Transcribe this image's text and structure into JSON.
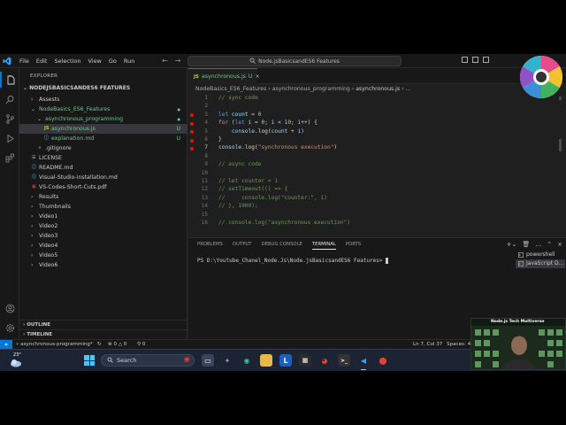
{
  "titlebar": {
    "menu": [
      "File",
      "Edit",
      "Selection",
      "View",
      "Go",
      "Run"
    ],
    "command_center": "Node.jsBasicsandES6 Features"
  },
  "sidebar": {
    "title": "EXPLORER",
    "root": "NODEJSBASICSANDES6 FEATURES",
    "items": [
      {
        "label": "Assests",
        "indent": 1,
        "type": "folder",
        "open": false
      },
      {
        "label": "NodeBasics_ES6_Features",
        "indent": 1,
        "type": "folder",
        "open": true,
        "color": "#73c991"
      },
      {
        "label": "asynchronous_programming",
        "indent": 2,
        "type": "folder",
        "open": true,
        "color": "#73c991"
      },
      {
        "label": "asynchronous.js",
        "indent": 3,
        "type": "js",
        "status": "U",
        "selected": true,
        "color": "#73c991"
      },
      {
        "label": "explanation.md",
        "indent": 3,
        "type": "md",
        "status": "U",
        "color": "#73c991"
      },
      {
        "label": ".gitignore",
        "indent": 2,
        "type": "git"
      },
      {
        "label": "LICENSE",
        "indent": 1,
        "type": "license"
      },
      {
        "label": "README.md",
        "indent": 1,
        "type": "md"
      },
      {
        "label": "Visual-Studio-installation.md",
        "indent": 1,
        "type": "md"
      },
      {
        "label": "VS-Codes-Short-Cuts.pdf",
        "indent": 1,
        "type": "pdf"
      },
      {
        "label": "Results",
        "indent": 1,
        "type": "folder",
        "open": false
      },
      {
        "label": "Thumbnails",
        "indent": 1,
        "type": "folder",
        "open": false
      },
      {
        "label": "Video1",
        "indent": 1,
        "type": "folder",
        "open": false
      },
      {
        "label": "Video2",
        "indent": 1,
        "type": "folder",
        "open": false
      },
      {
        "label": "Video3",
        "indent": 1,
        "type": "folder",
        "open": false
      },
      {
        "label": "Video4",
        "indent": 1,
        "type": "folder",
        "open": false
      },
      {
        "label": "Video5",
        "indent": 1,
        "type": "folder",
        "open": false
      },
      {
        "label": "Video6",
        "indent": 1,
        "type": "folder",
        "open": false
      }
    ],
    "outline": "OUTLINE",
    "timeline": "TIMELINE"
  },
  "editor": {
    "tab_label": "asynchronous.js",
    "tab_status": "U",
    "breadcrumb": [
      "NodeBasics_ES6_Features",
      "asynchronous_programming",
      "asynchronous.js",
      "..."
    ],
    "current_line": 7,
    "breakpoint_lines": [
      3,
      4,
      5,
      6,
      7
    ],
    "lines": [
      {
        "n": "1",
        "text": "// sync code"
      },
      {
        "n": "2",
        "text": ""
      },
      {
        "n": "3",
        "text": "let count = 0"
      },
      {
        "n": "4",
        "text": "for (let i = 0; i < 10; i++) {"
      },
      {
        "n": "5",
        "text": "    console.log(count + i)"
      },
      {
        "n": "6",
        "text": "}"
      },
      {
        "n": "7",
        "text": "console.log(\"synchronous execution\")"
      },
      {
        "n": "8",
        "text": ""
      },
      {
        "n": "9",
        "text": "// async code"
      },
      {
        "n": "10",
        "text": ""
      },
      {
        "n": "11",
        "text": "// let counter = 1"
      },
      {
        "n": "12",
        "text": "// setTimeout(() => {"
      },
      {
        "n": "13",
        "text": "//     console.log(\"counter:\", 1)"
      },
      {
        "n": "14",
        "text": "// }, 1000);"
      },
      {
        "n": "15",
        "text": ""
      },
      {
        "n": "16",
        "text": "// console.log(\"asynchronous execution\")"
      }
    ]
  },
  "panel": {
    "tabs": [
      "PROBLEMS",
      "OUTPUT",
      "DEBUG CONSOLE",
      "TERMINAL",
      "PORTS"
    ],
    "active_tab": "TERMINAL",
    "prompt": "PS D:\\Youtube_Chanel_Node.Js\\Node.jsBasicsandES6 Features>",
    "terminals": [
      "powershell",
      "JavaScript D..."
    ]
  },
  "statusbar": {
    "branch": "asynchronous-programming*",
    "errors": "0",
    "warnings": "0",
    "ports": "0",
    "position": "Ln 7, Col 37",
    "spaces": "Spaces: 4"
  },
  "taskbar": {
    "temperature": "23°",
    "search_placeholder": "Search"
  },
  "overlay": {
    "webcam_title": "Node.js Tech Multiverse"
  }
}
